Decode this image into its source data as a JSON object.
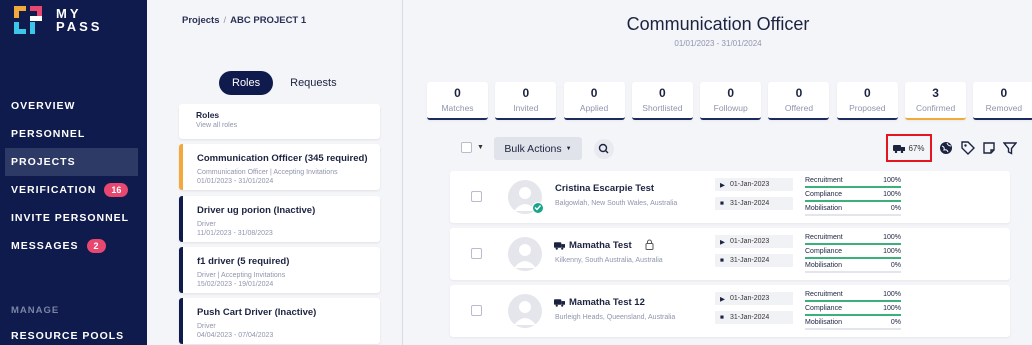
{
  "app": {
    "logo_line1": "MY",
    "logo_line2": "PASS",
    "logo_mark": "TM"
  },
  "nav": {
    "items": [
      {
        "label": "OVERVIEW"
      },
      {
        "label": "PERSONNEL"
      },
      {
        "label": "PROJECTS"
      },
      {
        "label": "VERIFICATION",
        "badge": "16"
      },
      {
        "label": "INVITE PERSONNEL"
      },
      {
        "label": "MESSAGES",
        "badge": "2"
      }
    ],
    "section_label": "MANAGE",
    "resource_pools": "RESOURCE POOLS"
  },
  "breadcrumb": {
    "root": "Projects",
    "separator": "/",
    "current": "ABC PROJECT 1"
  },
  "left_tabs": [
    {
      "label": "Roles"
    },
    {
      "label": "Requests"
    }
  ],
  "roles_header": {
    "title": "Roles",
    "subtitle": "View all roles"
  },
  "roles": [
    {
      "title": "Communication Officer (345 required)",
      "line1": "Communication Officer | Accepting Invitations",
      "line2": "01/01/2023 - 31/01/2024"
    },
    {
      "title": "Driver ug porion (Inactive)",
      "line1": "Driver",
      "line2": "11/01/2023 - 31/08/2023"
    },
    {
      "title": "f1 driver (5 required)",
      "line1": "Driver | Accepting Invitations",
      "line2": "15/02/2023 - 19/01/2024"
    },
    {
      "title": "Push Cart Driver (Inactive)",
      "line1": "Driver",
      "line2": "04/04/2023 - 07/04/2023"
    }
  ],
  "page": {
    "title": "Communication Officer",
    "daterange": "01/01/2023 - 31/01/2024"
  },
  "stats": [
    {
      "num": "0",
      "label": "Matches"
    },
    {
      "num": "0",
      "label": "Invited"
    },
    {
      "num": "0",
      "label": "Applied"
    },
    {
      "num": "0",
      "label": "Shortlisted"
    },
    {
      "num": "0",
      "label": "Followup"
    },
    {
      "num": "0",
      "label": "Offered"
    },
    {
      "num": "0",
      "label": "Proposed"
    },
    {
      "num": "3",
      "label": "Confirmed"
    },
    {
      "num": "0",
      "label": "Removed"
    }
  ],
  "toolbar": {
    "bulk_actions": "Bulk Actions",
    "vehicle_pct": "67%",
    "icons": [
      "search-icon",
      "car-icon",
      "globe-icon",
      "tag-icon",
      "note-icon",
      "filter-icon"
    ]
  },
  "candidates": [
    {
      "name": "Cristina Escarpie Test",
      "location": "Balgowlah, New South Wales, Australia",
      "start": "01-Jan-2023",
      "end": "31-Jan-2024",
      "verified": true,
      "vehicle": false,
      "locked": false,
      "progress": [
        {
          "label": "Recruitment",
          "value": "100%",
          "fill": 1.0
        },
        {
          "label": "Compliance",
          "value": "100%",
          "fill": 1.0
        },
        {
          "label": "Mobilisation",
          "value": "0%",
          "fill": 0
        }
      ]
    },
    {
      "name": "Mamatha Test",
      "location": "Kilkenny, South Australia, Australia",
      "start": "01-Jan-2023",
      "end": "31-Jan-2024",
      "verified": false,
      "vehicle": true,
      "locked": true,
      "progress": [
        {
          "label": "Recruitment",
          "value": "100%",
          "fill": 1.0
        },
        {
          "label": "Compliance",
          "value": "100%",
          "fill": 1.0
        },
        {
          "label": "Mobilisation",
          "value": "0%",
          "fill": 0
        }
      ]
    },
    {
      "name": "Mamatha Test 12",
      "location": "Burleigh Heads, Queensland, Australia",
      "start": "01-Jan-2023",
      "end": "31-Jan-2024",
      "verified": false,
      "vehicle": true,
      "locked": false,
      "progress": [
        {
          "label": "Recruitment",
          "value": "100%",
          "fill": 1.0
        },
        {
          "label": "Compliance",
          "value": "100%",
          "fill": 1.0
        },
        {
          "label": "Mobilisation",
          "value": "0%",
          "fill": 0
        }
      ]
    }
  ],
  "colors": {
    "sidebar": "#0f1b4c",
    "accent": "#f2a93b",
    "badge": "#e8476f",
    "progress": "#3bb07a",
    "highlight_box": "#e3161f"
  }
}
